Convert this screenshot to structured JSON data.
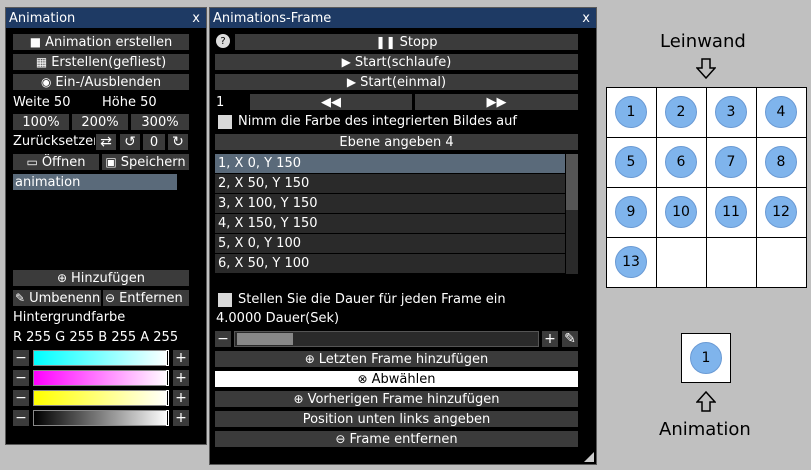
{
  "animation_panel": {
    "title": "Animation",
    "close": "x",
    "create_btn": "Animation erstellen",
    "create_tiled_btn": "Erstellen(gefliest)",
    "toggle_btn": "Ein-/Ausblenden",
    "width_label": "Weite 50",
    "height_label": "Höhe 50",
    "zoom": [
      "100%",
      "200%",
      "300%"
    ],
    "reset_label": "Zurücksetzen",
    "rotation_value": "0",
    "open_btn": "Öffnen",
    "save_btn": "Speichern",
    "name_value": "animation",
    "add_btn": "Hinzufügen",
    "rename_btn": "Umbenennen",
    "remove_btn": "Entfernen",
    "bg_label": "Hintergrundfarbe",
    "rgba_label": "R 255 G 255 B 255 A 255",
    "sliders": [
      {
        "name": "cyan",
        "value": 1.0
      },
      {
        "name": "magenta",
        "value": 1.0
      },
      {
        "name": "yellow",
        "value": 1.0
      },
      {
        "name": "alpha",
        "value": 1.0
      }
    ],
    "minus": "−",
    "plus": "+"
  },
  "frame_panel": {
    "title": "Animations-Frame",
    "close": "x",
    "help": "?",
    "stop_btn": "Stopp",
    "start_loop_btn": "Start(schlaufe)",
    "start_once_btn": "Start(einmal)",
    "frame_index": "1",
    "use_color_label": "Nimm die Farbe des integrierten Bildes auf",
    "layer_btn": "Ebene angeben 4",
    "frames": [
      "1, X 0, Y 150",
      "2, X 50, Y 150",
      "3, X 100, Y 150",
      "4, X 150, Y 150",
      "5, X 0, Y 100",
      "6, X 50, Y 100"
    ],
    "duration_check_label": "Stellen Sie die Dauer für jeden Frame ein",
    "duration_label": "4.0000 Dauer(Sek)",
    "add_last_btn": "Letzten Frame hinzufügen",
    "deselect_btn": "Abwählen",
    "add_prev_btn": "Vorherigen Frame hinzufügen",
    "pos_bottom_left_btn": "Position unten links angeben",
    "remove_frame_btn": "Frame entfernen"
  },
  "canvas": {
    "title": "Leinwand",
    "cells": [
      "1",
      "2",
      "3",
      "4",
      "5",
      "6",
      "7",
      "8",
      "9",
      "10",
      "11",
      "12",
      "13"
    ],
    "preview_value": "1",
    "animation_label": "Animation"
  }
}
